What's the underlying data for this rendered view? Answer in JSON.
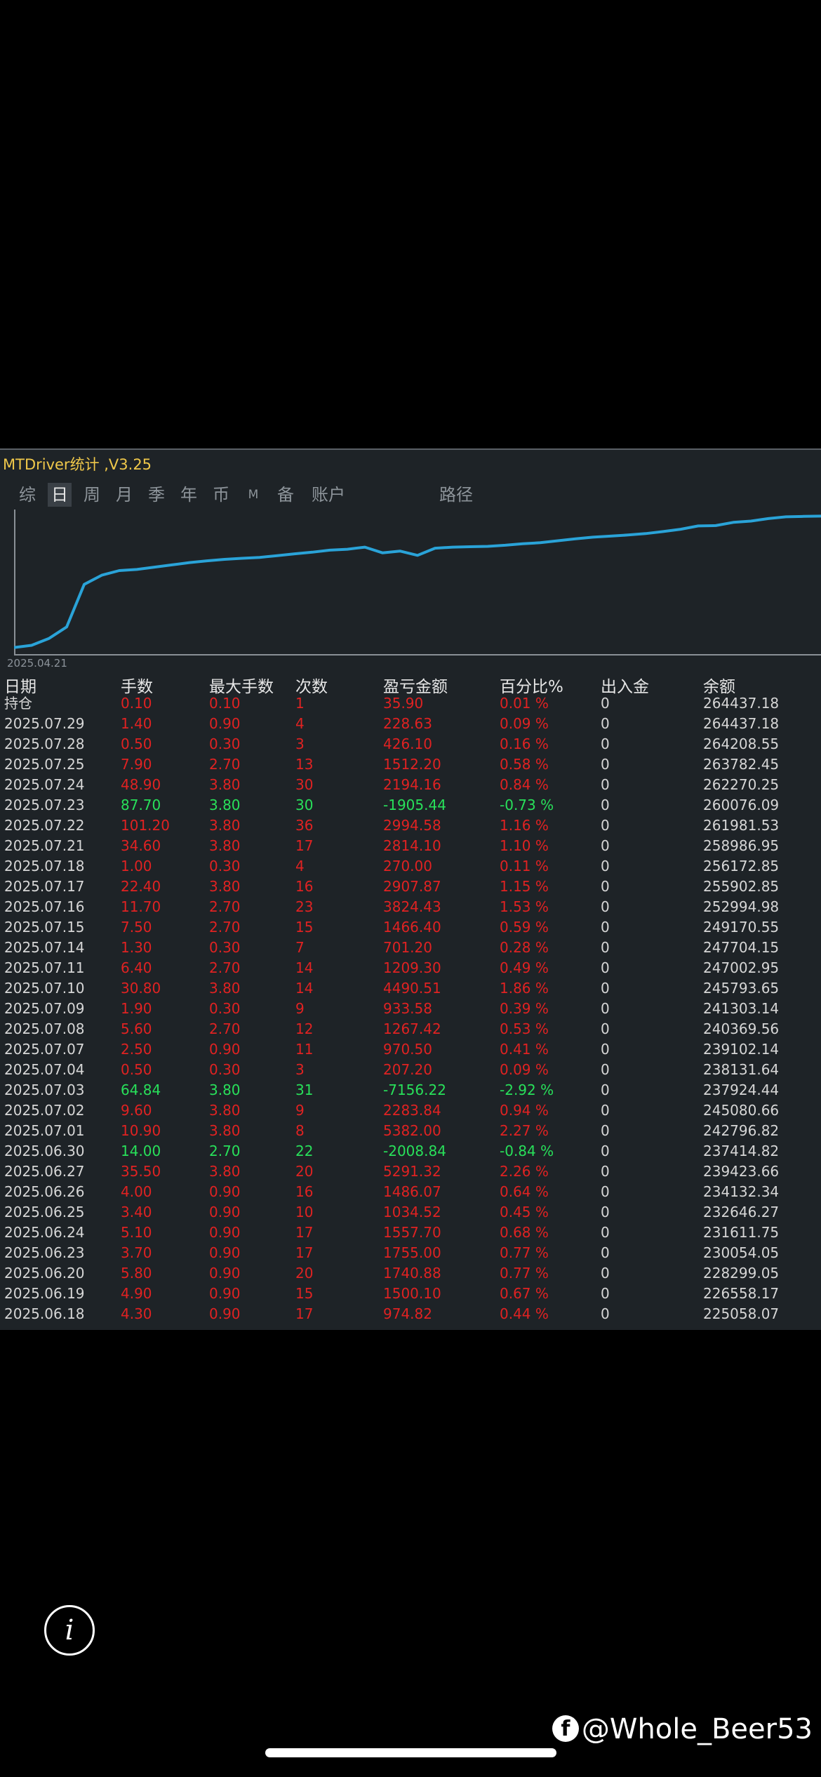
{
  "app": {
    "title": "MTDriver统计 ,V3.25"
  },
  "tabs": [
    {
      "label": "综",
      "active": false
    },
    {
      "label": "日",
      "active": true
    },
    {
      "label": "周",
      "active": false
    },
    {
      "label": "月",
      "active": false
    },
    {
      "label": "季",
      "active": false
    },
    {
      "label": "年",
      "active": false
    },
    {
      "label": "币",
      "active": false
    },
    {
      "label": "M",
      "active": false
    },
    {
      "label": "备",
      "active": false
    },
    {
      "label": "账户",
      "active": false
    },
    {
      "label": "路径",
      "active": false
    }
  ],
  "chart": {
    "start_date_label": "2025.04.21",
    "line_color": "#2aa3d8",
    "points_balance": [
      150000,
      152000,
      158000,
      168000,
      205000,
      213000,
      217000,
      218000,
      220000,
      222000,
      224000,
      225500,
      226800,
      227700,
      228500,
      230000,
      231600,
      233000,
      234800,
      235600,
      237400,
      232500,
      234000,
      230300,
      236500,
      237400,
      237800,
      238100,
      239100,
      240400,
      241300,
      243000,
      244700,
      246100,
      247000,
      248000,
      249200,
      251000,
      253000,
      255900,
      256200,
      258987,
      260076,
      262270,
      263782,
      264208,
      264437
    ],
    "ylim": [
      148000,
      266500
    ]
  },
  "table": {
    "headers": {
      "date": "日期",
      "lots": "手数",
      "max_lots": "最大手数",
      "count": "次数",
      "pnl": "盈亏金额",
      "pct": "百分比%",
      "io": "出入金",
      "balance": "余额"
    },
    "rows": [
      {
        "date": "持仓",
        "lots": "0.10",
        "max": "0.10",
        "cnt": "1",
        "pnl": "35.90",
        "pct": "0.01 %",
        "io": "0",
        "bal": "264437.18",
        "status": "red"
      },
      {
        "date": "2025.07.29",
        "lots": "1.40",
        "max": "0.90",
        "cnt": "4",
        "pnl": "228.63",
        "pct": "0.09 %",
        "io": "0",
        "bal": "264437.18",
        "status": "red"
      },
      {
        "date": "2025.07.28",
        "lots": "0.50",
        "max": "0.30",
        "cnt": "3",
        "pnl": "426.10",
        "pct": "0.16 %",
        "io": "0",
        "bal": "264208.55",
        "status": "red"
      },
      {
        "date": "2025.07.25",
        "lots": "7.90",
        "max": "2.70",
        "cnt": "13",
        "pnl": "1512.20",
        "pct": "0.58 %",
        "io": "0",
        "bal": "263782.45",
        "status": "red"
      },
      {
        "date": "2025.07.24",
        "lots": "48.90",
        "max": "3.80",
        "cnt": "30",
        "pnl": "2194.16",
        "pct": "0.84 %",
        "io": "0",
        "bal": "262270.25",
        "status": "red"
      },
      {
        "date": "2025.07.23",
        "lots": "87.70",
        "max": "3.80",
        "cnt": "30",
        "pnl": "-1905.44",
        "pct": "-0.73 %",
        "io": "0",
        "bal": "260076.09",
        "status": "green"
      },
      {
        "date": "2025.07.22",
        "lots": "101.20",
        "max": "3.80",
        "cnt": "36",
        "pnl": "2994.58",
        "pct": "1.16 %",
        "io": "0",
        "bal": "261981.53",
        "status": "red"
      },
      {
        "date": "2025.07.21",
        "lots": "34.60",
        "max": "3.80",
        "cnt": "17",
        "pnl": "2814.10",
        "pct": "1.10 %",
        "io": "0",
        "bal": "258986.95",
        "status": "red"
      },
      {
        "date": "2025.07.18",
        "lots": "1.00",
        "max": "0.30",
        "cnt": "4",
        "pnl": "270.00",
        "pct": "0.11 %",
        "io": "0",
        "bal": "256172.85",
        "status": "red"
      },
      {
        "date": "2025.07.17",
        "lots": "22.40",
        "max": "3.80",
        "cnt": "16",
        "pnl": "2907.87",
        "pct": "1.15 %",
        "io": "0",
        "bal": "255902.85",
        "status": "red"
      },
      {
        "date": "2025.07.16",
        "lots": "11.70",
        "max": "2.70",
        "cnt": "23",
        "pnl": "3824.43",
        "pct": "1.53 %",
        "io": "0",
        "bal": "252994.98",
        "status": "red"
      },
      {
        "date": "2025.07.15",
        "lots": "7.50",
        "max": "2.70",
        "cnt": "15",
        "pnl": "1466.40",
        "pct": "0.59 %",
        "io": "0",
        "bal": "249170.55",
        "status": "red"
      },
      {
        "date": "2025.07.14",
        "lots": "1.30",
        "max": "0.30",
        "cnt": "7",
        "pnl": "701.20",
        "pct": "0.28 %",
        "io": "0",
        "bal": "247704.15",
        "status": "red"
      },
      {
        "date": "2025.07.11",
        "lots": "6.40",
        "max": "2.70",
        "cnt": "14",
        "pnl": "1209.30",
        "pct": "0.49 %",
        "io": "0",
        "bal": "247002.95",
        "status": "red"
      },
      {
        "date": "2025.07.10",
        "lots": "30.80",
        "max": "3.80",
        "cnt": "14",
        "pnl": "4490.51",
        "pct": "1.86 %",
        "io": "0",
        "bal": "245793.65",
        "status": "red"
      },
      {
        "date": "2025.07.09",
        "lots": "1.90",
        "max": "0.30",
        "cnt": "9",
        "pnl": "933.58",
        "pct": "0.39 %",
        "io": "0",
        "bal": "241303.14",
        "status": "red"
      },
      {
        "date": "2025.07.08",
        "lots": "5.60",
        "max": "2.70",
        "cnt": "12",
        "pnl": "1267.42",
        "pct": "0.53 %",
        "io": "0",
        "bal": "240369.56",
        "status": "red"
      },
      {
        "date": "2025.07.07",
        "lots": "2.50",
        "max": "0.90",
        "cnt": "11",
        "pnl": "970.50",
        "pct": "0.41 %",
        "io": "0",
        "bal": "239102.14",
        "status": "red"
      },
      {
        "date": "2025.07.04",
        "lots": "0.50",
        "max": "0.30",
        "cnt": "3",
        "pnl": "207.20",
        "pct": "0.09 %",
        "io": "0",
        "bal": "238131.64",
        "status": "red"
      },
      {
        "date": "2025.07.03",
        "lots": "64.84",
        "max": "3.80",
        "cnt": "31",
        "pnl": "-7156.22",
        "pct": "-2.92 %",
        "io": "0",
        "bal": "237924.44",
        "status": "green"
      },
      {
        "date": "2025.07.02",
        "lots": "9.60",
        "max": "3.80",
        "cnt": "9",
        "pnl": "2283.84",
        "pct": "0.94 %",
        "io": "0",
        "bal": "245080.66",
        "status": "red"
      },
      {
        "date": "2025.07.01",
        "lots": "10.90",
        "max": "3.80",
        "cnt": "8",
        "pnl": "5382.00",
        "pct": "2.27 %",
        "io": "0",
        "bal": "242796.82",
        "status": "red"
      },
      {
        "date": "2025.06.30",
        "lots": "14.00",
        "max": "2.70",
        "cnt": "22",
        "pnl": "-2008.84",
        "pct": "-0.84 %",
        "io": "0",
        "bal": "237414.82",
        "status": "green"
      },
      {
        "date": "2025.06.27",
        "lots": "35.50",
        "max": "3.80",
        "cnt": "20",
        "pnl": "5291.32",
        "pct": "2.26 %",
        "io": "0",
        "bal": "239423.66",
        "status": "red"
      },
      {
        "date": "2025.06.26",
        "lots": "4.00",
        "max": "0.90",
        "cnt": "16",
        "pnl": "1486.07",
        "pct": "0.64 %",
        "io": "0",
        "bal": "234132.34",
        "status": "red"
      },
      {
        "date": "2025.06.25",
        "lots": "3.40",
        "max": "0.90",
        "cnt": "10",
        "pnl": "1034.52",
        "pct": "0.45 %",
        "io": "0",
        "bal": "232646.27",
        "status": "red"
      },
      {
        "date": "2025.06.24",
        "lots": "5.10",
        "max": "0.90",
        "cnt": "17",
        "pnl": "1557.70",
        "pct": "0.68 %",
        "io": "0",
        "bal": "231611.75",
        "status": "red"
      },
      {
        "date": "2025.06.23",
        "lots": "3.70",
        "max": "0.90",
        "cnt": "17",
        "pnl": "1755.00",
        "pct": "0.77 %",
        "io": "0",
        "bal": "230054.05",
        "status": "red"
      },
      {
        "date": "2025.06.20",
        "lots": "5.80",
        "max": "0.90",
        "cnt": "20",
        "pnl": "1740.88",
        "pct": "0.77 %",
        "io": "0",
        "bal": "228299.05",
        "status": "red"
      },
      {
        "date": "2025.06.19",
        "lots": "4.90",
        "max": "0.90",
        "cnt": "15",
        "pnl": "1500.10",
        "pct": "0.67 %",
        "io": "0",
        "bal": "226558.17",
        "status": "red"
      },
      {
        "date": "2025.06.18",
        "lots": "4.30",
        "max": "0.90",
        "cnt": "17",
        "pnl": "974.82",
        "pct": "0.44 %",
        "io": "0",
        "bal": "225058.07",
        "status": "red"
      }
    ]
  },
  "colors": {
    "profit": "#e02222",
    "loss": "#28e05a",
    "title": "#f0c84a",
    "panel_bg": "#1e2327"
  },
  "overlay": {
    "info_icon_glyph": "i",
    "watermark_icon": "f",
    "watermark": "@Whole_Beer53"
  }
}
